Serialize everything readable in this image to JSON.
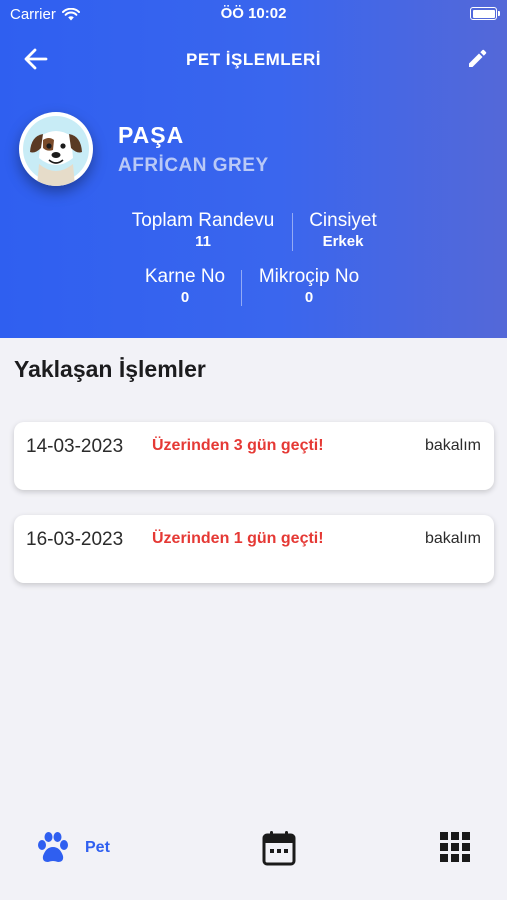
{
  "status_bar": {
    "carrier": "Carrier",
    "time": "ÖÖ 10:02"
  },
  "nav": {
    "title": "PET İŞLEMLERİ",
    "back_icon": "arrow-left-icon",
    "edit_icon": "pencil-icon"
  },
  "pet": {
    "name": "PAŞA",
    "breed": "AFRİCAN GREY"
  },
  "stats": {
    "total_appointments": {
      "label": "Toplam Randevu",
      "value": "11"
    },
    "gender": {
      "label": "Cinsiyet",
      "value": "Erkek"
    },
    "card_no": {
      "label": "Karne No",
      "value": "0"
    },
    "microchip_no": {
      "label": "Mikroçip No",
      "value": "0"
    }
  },
  "upcoming": {
    "title": "Yaklaşan İşlemler",
    "items": [
      {
        "date": "14-03-2023",
        "status": "Üzerinden 3 gün geçti!",
        "type": "bakalım"
      },
      {
        "date": "16-03-2023",
        "status": "Üzerinden 1 gün geçti!",
        "type": "bakalım"
      }
    ]
  },
  "tabbar": {
    "pet_label": "Pet",
    "accent": "#2f5ff0",
    "icons": [
      "paw-icon",
      "calendar-icon",
      "grid-icon"
    ]
  },
  "colors": {
    "header_start": "#2f5ff0",
    "header_end": "#5468d8",
    "warning": "#e53935",
    "breed": "#b9c9f7"
  }
}
